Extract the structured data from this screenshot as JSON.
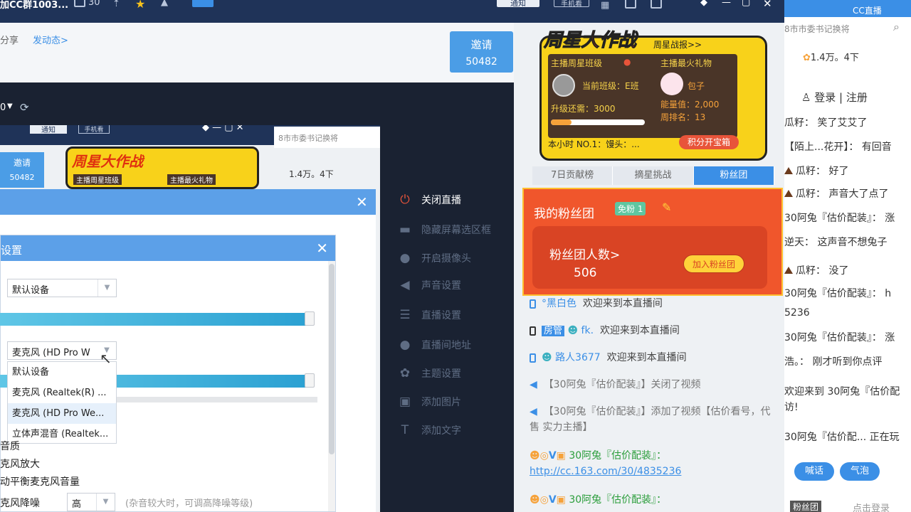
{
  "topbar": {
    "title": "加CC群1003...",
    "count": "30",
    "notify": "通知",
    "mobile": "手机看"
  },
  "share": {
    "share": "分享",
    "post": "发动态>"
  },
  "invite": {
    "label": "邀请",
    "count": "50482"
  },
  "toolbar": {
    "zero": "0"
  },
  "menu": [
    {
      "icon": "power-icon",
      "label": "关闭直播"
    },
    {
      "icon": "screen-icon",
      "label": "隐藏屏幕选区框"
    },
    {
      "icon": "location-icon",
      "label": "开启摄像头"
    },
    {
      "icon": "speaker-icon",
      "label": "声音设置"
    },
    {
      "icon": "sliders-icon",
      "label": "直播设置"
    },
    {
      "icon": "location-icon",
      "label": "直播间地址"
    },
    {
      "icon": "palette-icon",
      "label": "主题设置"
    },
    {
      "icon": "image-icon",
      "label": "添加图片"
    },
    {
      "icon": "text-icon",
      "label": "添加文字"
    }
  ],
  "inner": {
    "notify": "通知",
    "mobile": "手机看",
    "search": "8市市委书记换将",
    "invite": "邀请",
    "invite_count": "50482",
    "banner": "周星大作战",
    "sub1": "主播周星班级",
    "sub2": "主播最火礼物",
    "stats": "1.4万。4下"
  },
  "audio": {
    "title": "设置",
    "device": "默认设备",
    "mic_selected": "麦克风 (HD Pro W",
    "options": [
      "默认设备",
      "麦克风 (Realtek(R) ...",
      "麦克风 (HD Pro We...",
      "立体声混音 (Realtek..."
    ],
    "l1": "音质",
    "l2": "克风放大",
    "l3": "动平衡麦克风音量",
    "l4": "克风降噪",
    "noise": "高",
    "noise_hint": "(杂音较大时，可调高降噪等级)"
  },
  "poster": {
    "title": "周星大作战",
    "report": "周星战报>>",
    "class_label": "主播周星班级",
    "gift_label": "主播最火礼物",
    "class_now": "当前班级：E班",
    "gift_name": "包子",
    "upgrade": "升级还需：3000",
    "energy": "能量值：2,000",
    "rank": "周排名：13",
    "hour": "本小时 NO.1：馒头：...",
    "treasure": "积分开宝箱"
  },
  "tabs": [
    "7日贡献榜",
    "摘星挑战",
    "粉丝团"
  ],
  "fans": {
    "title": "我的粉丝团",
    "badge": "免粉",
    "badge_num": "1",
    "count_label": "粉丝团人数>",
    "count": "506",
    "join": "加入粉丝团"
  },
  "chat": {
    "m1_user": "°黑白色",
    "m1_text": "欢迎来到本直播间",
    "m2_tag": "房管",
    "m2_user": "fk.",
    "m2_text": "欢迎来到本直播间",
    "m3_user": "路人3677",
    "m3_text": "欢迎来到本直播间",
    "m4": "【30阿兔『估价配装』】关闭了视频",
    "m5": "【30阿兔『估价配装』】添加了视频【估价看号，代售  实力主播】",
    "m6_user": "30阿兔『估价配装』：",
    "m6_link": "http://cc.163.com/30/4835236",
    "m7_user": "30阿兔『估价配装』："
  },
  "far": {
    "brand": "CC直播",
    "search": "8市市委书记换将",
    "stats": "1.4万。4下",
    "login": "登录",
    "register": "注册",
    "lines": [
      "瓜籽：  笑了艾艾了",
      "【陌上...花开】：  有回音",
      "瓜籽：  好了",
      "瓜籽：  声音大了点了",
      "30阿兔『估价配装』：  涨",
      "逆天：  这声音不想兔子",
      "瓜籽：  没了",
      "30阿兔『估价配装』：  h",
      "5236",
      "30阿兔『估价配装』：  涨",
      "浩。：  刚才听到你点评",
      "欢迎来到 30阿兔『估价配",
      "访!",
      "30阿兔『估价配...  正在玩"
    ],
    "shout": "喊话",
    "bubble": "气泡",
    "fans": "粉丝团",
    "login_hint": "点击登录"
  }
}
